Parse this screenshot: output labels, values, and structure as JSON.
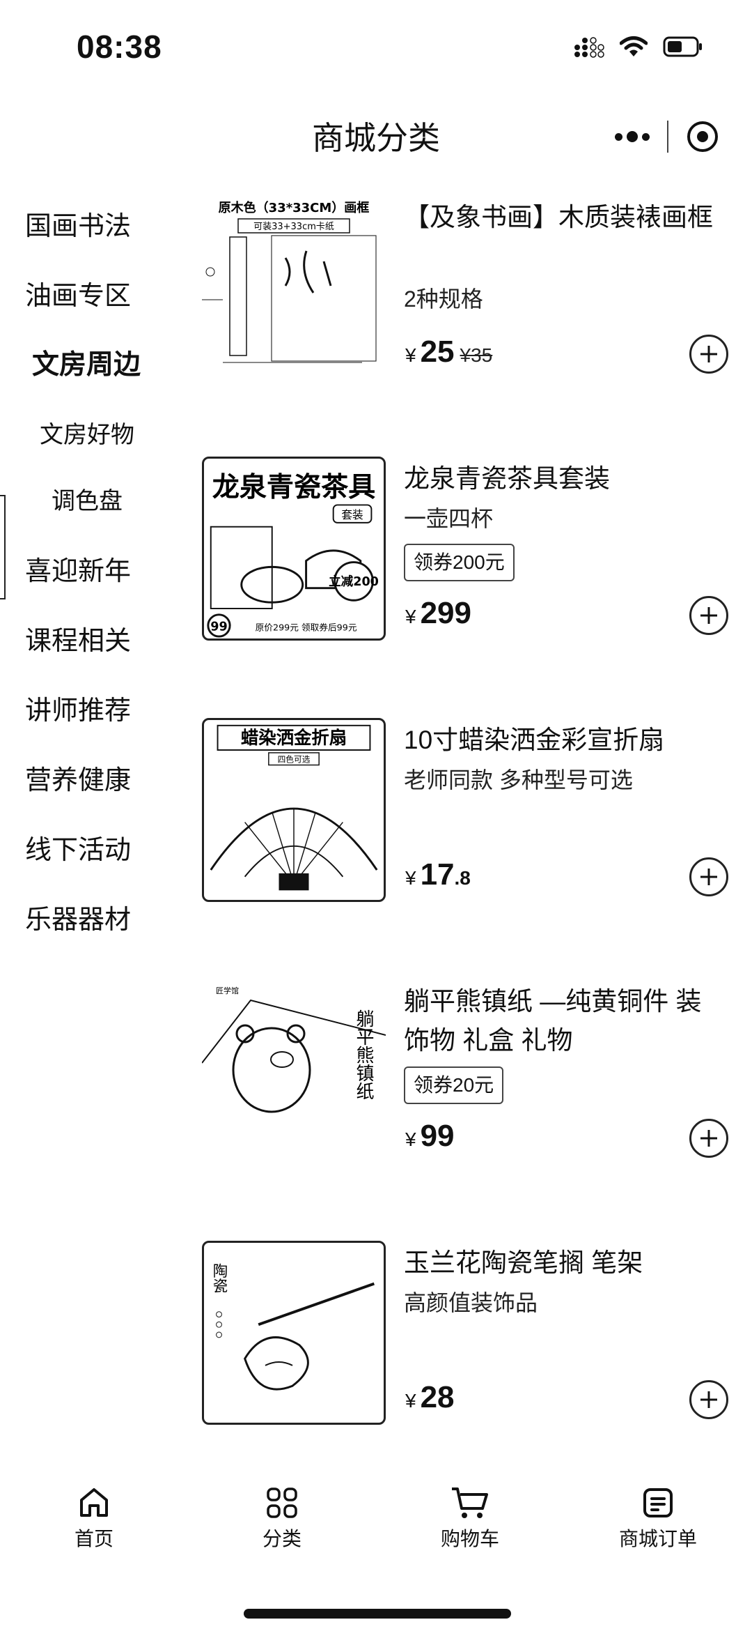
{
  "status_bar": {
    "time": "08:38"
  },
  "nav": {
    "title": "商城分类"
  },
  "sidebar": {
    "items": [
      {
        "label": "国画书法"
      },
      {
        "label": "油画专区"
      },
      {
        "label": "文房周边"
      },
      {
        "label": "文房好物"
      },
      {
        "label": "调色盘"
      },
      {
        "label": "喜迎新年"
      },
      {
        "label": "课程相关"
      },
      {
        "label": "讲师推荐"
      },
      {
        "label": "营养健康"
      },
      {
        "label": "线下活动"
      },
      {
        "label": "乐器器材"
      }
    ]
  },
  "products": [
    {
      "title": "【及象书画】木质装裱画框",
      "subtitle": "2种规格",
      "price_symbol": "¥",
      "price": "25",
      "original_price": "¥35",
      "thumb": {
        "top_text": "原木色（33*33CM）画框",
        "sub_text": "可装33+33cm卡纸"
      }
    },
    {
      "title": "龙泉青瓷茶具套装",
      "subtitle": "一壶四杯",
      "coupon": "领券200元",
      "price_symbol": "¥",
      "price": "299",
      "thumb": {
        "top_text": "龙泉青瓷茶具",
        "tag": "套装",
        "badge": "立减200",
        "bottom_text": "原价299元 领取券后99元",
        "circle": "99"
      }
    },
    {
      "title": "10寸蜡染洒金彩宣折扇",
      "subtitle": "老师同款 多种型号可选",
      "price_symbol": "¥",
      "price": "17",
      "price_decimal": ".8",
      "thumb": {
        "top_text": "蜡染洒金折扇",
        "tag": "四色可选"
      }
    },
    {
      "title": "躺平熊镇纸 —纯黄铜件 装饰物 礼盒 礼物",
      "coupon": "领券20元",
      "price_symbol": "¥",
      "price": "99",
      "thumb": {
        "side_text": "躺平熊镇纸",
        "logo": "匠学馆"
      }
    },
    {
      "title": "玉兰花陶瓷笔搁 笔架",
      "subtitle": "高颜值装饰品",
      "price_symbol": "¥",
      "price": "28",
      "thumb": {
        "side_text": "陶瓷"
      }
    }
  ],
  "tab_bar": {
    "tabs": [
      {
        "label": "首页",
        "icon": "home-icon"
      },
      {
        "label": "分类",
        "icon": "grid-icon"
      },
      {
        "label": "购物车",
        "icon": "cart-icon"
      },
      {
        "label": "商城订单",
        "icon": "order-icon"
      }
    ]
  }
}
